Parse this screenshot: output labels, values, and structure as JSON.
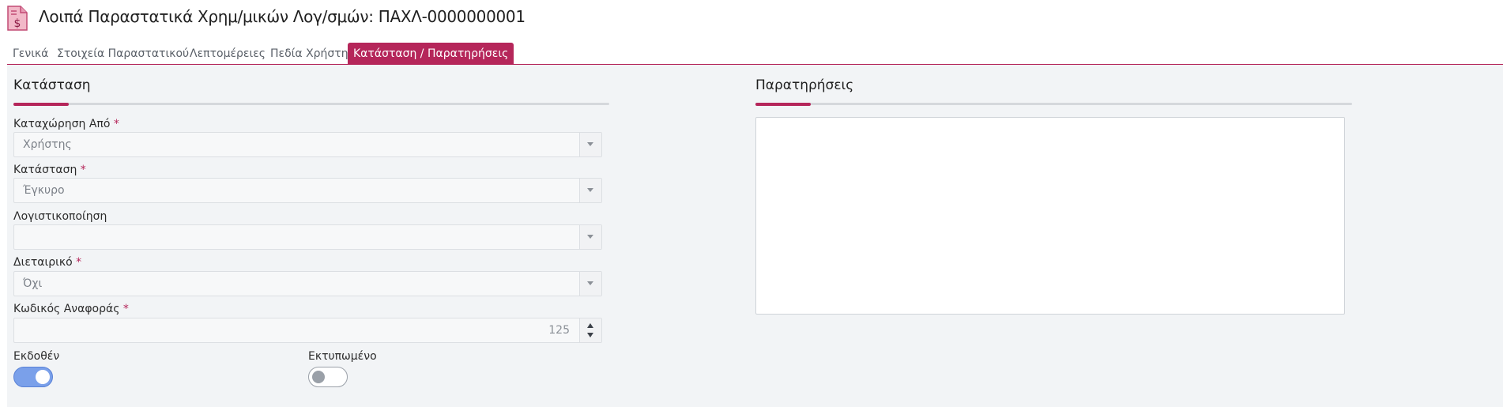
{
  "header": {
    "title": "Λοιπά Παραστατικά Χρημ/μικών Λογ/σμών: ΠΑΧΛ-0000000001",
    "icon": "invoice-dollar-icon",
    "icon_symbol": "$"
  },
  "tabs": [
    {
      "label": "Γενικά",
      "active": false
    },
    {
      "label": "Στοιχεία Παραστατικού",
      "active": false
    },
    {
      "label": "Λεπτομέρειες",
      "active": false
    },
    {
      "label": "Πεδία Χρήστη",
      "active": false
    },
    {
      "label": "Κατάσταση / Παρατηρήσεις",
      "active": true
    }
  ],
  "status_section": {
    "title": "Κατάσταση",
    "fields": {
      "entry_from": {
        "label": "Καταχώρηση Από",
        "required": "*",
        "value": "Χρήστης"
      },
      "status": {
        "label": "Κατάσταση",
        "required": "*",
        "value": "Έγκυρο"
      },
      "accounting": {
        "label": "Λογιστικοποίηση",
        "value": ""
      },
      "intercompany": {
        "label": "Διεταιρικό",
        "required": "*",
        "value": "Όχι"
      },
      "reference_code": {
        "label": "Κωδικός Αναφοράς",
        "required": "*",
        "value": "125"
      }
    },
    "toggles": {
      "issued": {
        "label": "Εκδοθέν",
        "on": true
      },
      "printed": {
        "label": "Εκτυπωμένο",
        "on": false
      }
    }
  },
  "notes_section": {
    "title": "Παρατηρήσεις",
    "value": ""
  },
  "colors": {
    "accent": "#b5265a",
    "toggle_on": "#7aa0ea",
    "panel_bg": "#f2f4f6"
  }
}
